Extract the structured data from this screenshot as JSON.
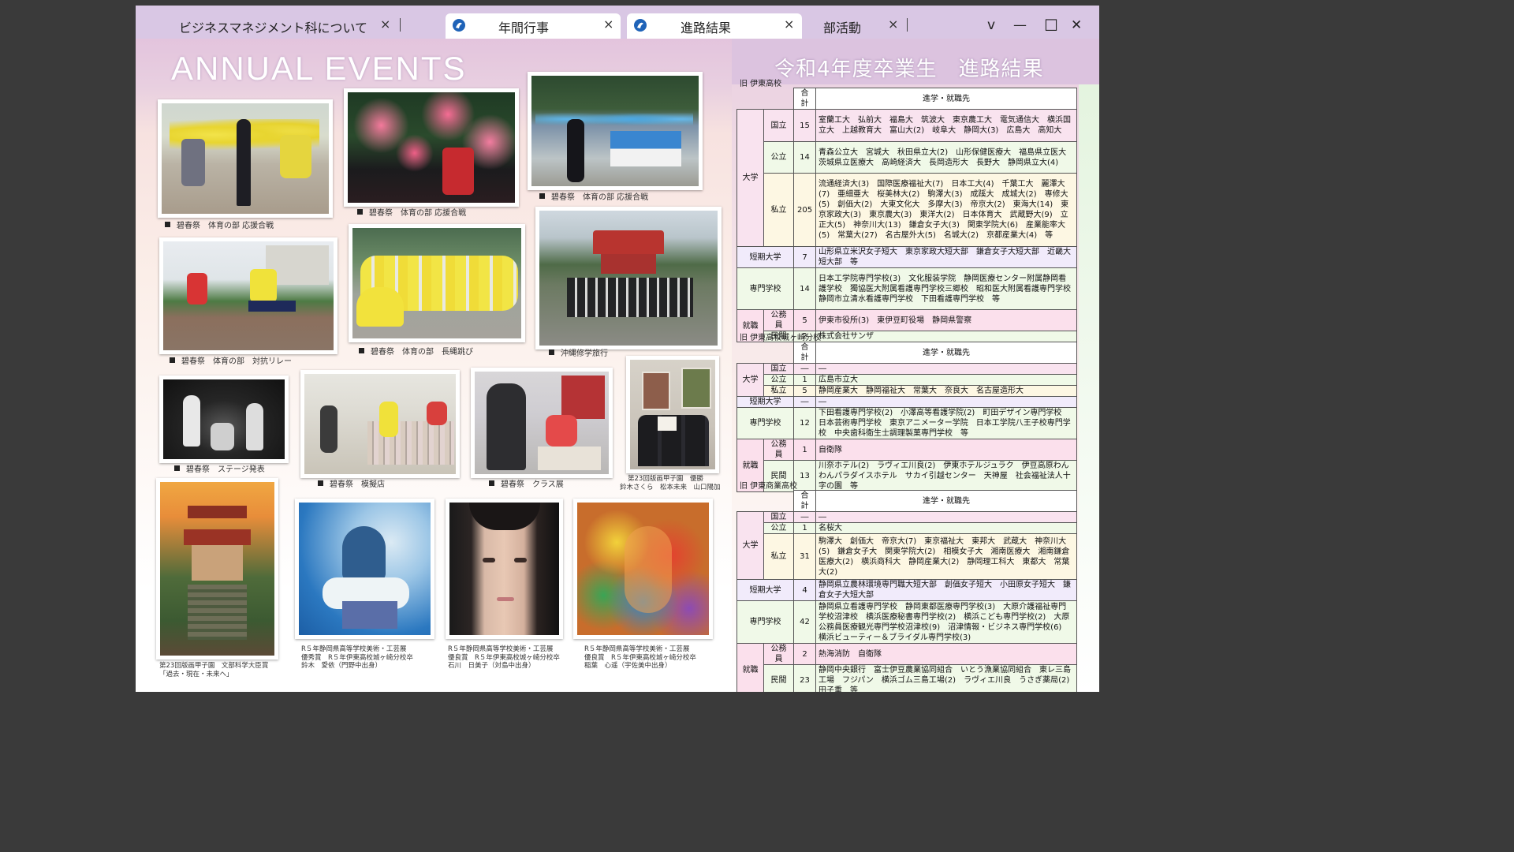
{
  "tabs": [
    {
      "label": "ビジネスマネジメント科について",
      "close": "×"
    },
    {
      "label": "年間行事",
      "close": "×"
    },
    {
      "label": "進路結果",
      "close": "×"
    },
    {
      "label": "部活動",
      "close": "×"
    }
  ],
  "window_controls": {
    "chevron": "v",
    "minimize": "—",
    "maximize": "☐",
    "close": "✕"
  },
  "left": {
    "title": "ANNUAL EVENTS",
    "captions": {
      "p1": "碧春祭　体育の部 応援合戦",
      "p2": "碧春祭　体育の部 応援合戦",
      "p3": "碧春祭　体育の部 応援合戦",
      "p4": "碧春祭　体育の部　対抗リレー",
      "p5": "碧春祭　体育の部　長縄跳び",
      "p6": "沖縄修学旅行",
      "p7": "碧春祭　ステージ発表",
      "p8": "碧春祭　模擬店",
      "p9": "碧春祭　クラス展",
      "p10a": "第23回版画甲子園　優勝",
      "p10b": "鈴木さくら　松本未来　山口陽加",
      "p11a": "第23回版画甲子園　文部科学大臣賞",
      "p11b": "「過去・現在・未来へ」",
      "p12a": "R５年静岡県高等学校美術・工芸展",
      "p12b": "優秀賞　R５年伊東高校城ヶ崎分校卒",
      "p12c": "鈴木　愛依（門野中出身）",
      "p13a": "R５年静岡県高等学校美術・工芸展",
      "p13b": "優良賞　R５年伊東高校城ヶ崎分校卒",
      "p13c": "石川　日美子（対島中出身）",
      "p14a": "R５年静岡県高等学校美術・工芸展",
      "p14b": "優良賞　R５年伊東高校城ヶ崎分校卒",
      "p14c": "稲葉　心遥（宇佐美中出身）"
    }
  },
  "right": {
    "title": "令和4年度卒業生　進路結果",
    "header": {
      "total": "合計",
      "dest": "進学・就職先"
    },
    "labels": {
      "daigaku": "大学",
      "kokuritsu": "国立",
      "kouritsu": "公立",
      "shiritsu": "私立",
      "tandai": "短期大学",
      "senmon": "専門学校",
      "shushoku": "就職",
      "koumuin": "公務員",
      "minkan": "民間"
    },
    "s1": {
      "name": "旧 伊東高校",
      "koku": {
        "n": "15",
        "d": "室蘭工大　弘前大　福島大　筑波大　東京農工大　電気通信大　横浜国立大　上越教育大　富山大(2)　岐阜大　静岡大(3)　広島大　高知大"
      },
      "ko": {
        "n": "14",
        "d": "青森公立大　宮城大　秋田県立大(2)　山形保健医療大　福島県立医大　茨城県立医療大　高崎経済大　長岡造形大　長野大　静岡県立大(4)"
      },
      "shi": {
        "n": "205",
        "d": "流通経済大(3)　国際医療福祉大(7)　日本工大(4)　千葉工大　麗澤大(7)　亜細亜大　桜美林大(2)　駒澤大(3)　成蹊大　成城大(2)　専修大(5)　創価大(2)　大東文化大　多摩大(3)　帝京大(2)　東海大(14)　東京家政大(3)　東京農大(3)　東洋大(2)　日本体育大　武蔵野大(9)　立正大(5)　神奈川大(13)　鎌倉女子大(3)　関東学院大(6)　産業能率大(5)　常葉大(27)　名古屋外大(5)　名城大(2)　京都産業大(4)　等"
      },
      "tan": {
        "n": "7",
        "d": "山形県立米沢女子短大　東京家政大短大部　鎌倉女子大短大部　近畿大短大部　等"
      },
      "sen": {
        "n": "14",
        "d": "日本工学院専門学校(3)　文化服装学院　静岡医療センター附属静岡看護学校　獨協医大附属看護専門学校三郷校　昭和医大附属看護専門学校　静岡市立清水看護専門学校　下田看護専門学校　等"
      },
      "kou": {
        "n": "5",
        "d": "伊東市役所(3)　東伊豆町役場　静岡県警察"
      },
      "min": {
        "n": "2",
        "d": "株式会社サンザ"
      }
    },
    "s2": {
      "name": "旧 伊東高校城ヶ崎分校",
      "koku": {
        "n": "―",
        "d": "―"
      },
      "ko": {
        "n": "1",
        "d": "広島市立大"
      },
      "shi": {
        "n": "5",
        "d": "静岡産業大　静岡福祉大　常葉大　奈良大　名古屋造形大"
      },
      "tan": {
        "n": "―",
        "d": "―"
      },
      "sen": {
        "n": "12",
        "d": "下田看護専門学校(2)　小澤高等看護学院(2)　町田デザイン専門学校　日本芸術専門学校　東京アニメーター学院　日本工学院八王子校専門学校　中央歯科衛生士調理製菓専門学校　等"
      },
      "kou": {
        "n": "1",
        "d": "自衛隊"
      },
      "min": {
        "n": "13",
        "d": "川奈ホテル(2)　ラヴィエ川良(2)　伊東ホテルジュラク　伊豆高原わんわんパラダイスホテル　サカイ引越センター　天神屋　社会福祉法人十字の園　等"
      }
    },
    "s3": {
      "name": "旧 伊東商業高校",
      "koku": {
        "n": "―",
        "d": "―"
      },
      "ko": {
        "n": "1",
        "d": "名桜大"
      },
      "shi": {
        "n": "31",
        "d": "駒澤大　創価大　帝京大(7)　東京福祉大　東邦大　武蔵大　神奈川大(5)　鎌倉女子大　関東学院大(2)　相模女子大　湘南医療大　湘南鎌倉医療大(2)　横浜商科大　静岡産業大(2)　静岡理工科大　東都大　常葉大(2)"
      },
      "tan": {
        "n": "4",
        "d": "静岡県立農林環境専門職大短大部　創価女子短大　小田原女子短大　鎌倉女子大短大部"
      },
      "sen": {
        "n": "42",
        "d": "静岡県立看護専門学校　静岡東都医療専門学校(3)　大原介護福祉専門学校沼津校　横浜医療秘書専門学校(2)　横浜こども専門学校(2)　大原公務員医療観光専門学校沼津校(9)　沼津情報・ビジネス専門学校(6)　横浜ビューティー＆ブライダル専門学校(3)"
      },
      "kou": {
        "n": "2",
        "d": "熱海消防　自衛隊"
      },
      "min": {
        "n": "23",
        "d": "静岡中央銀行　富士伊豆農業協同組合　いとう漁業協同組合　東レ三島工場　フジパン　横浜ゴム三島工場(2)　ラヴィエ川良　うさぎ薬局(2)　田子重　等"
      }
    }
  }
}
